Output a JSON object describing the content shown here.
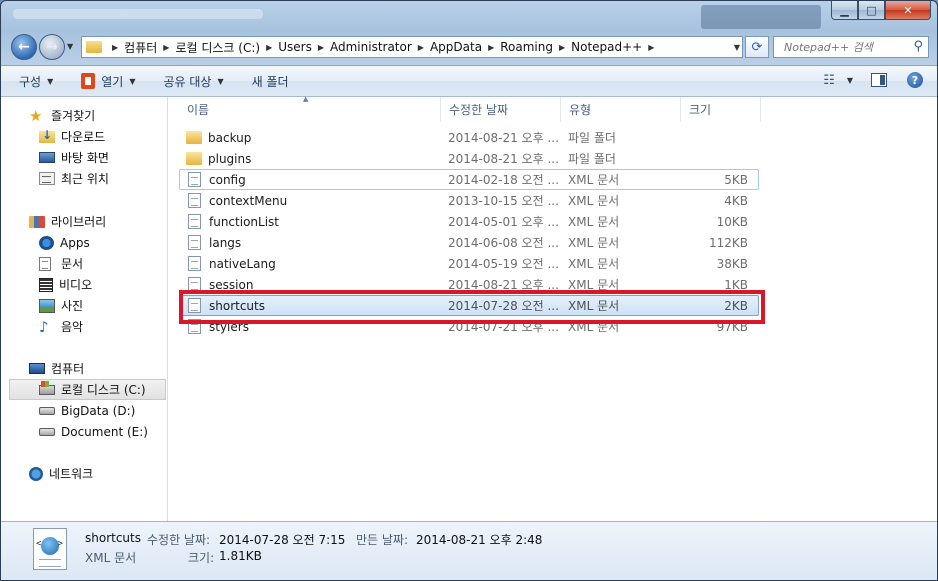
{
  "window": {
    "title": ""
  },
  "address": {
    "breadcrumbs": [
      "컴퓨터",
      "로컬 디스크 (C:)",
      "Users",
      "Administrator",
      "AppData",
      "Roaming",
      "Notepad++"
    ],
    "search_placeholder": "Notepad++ 검색"
  },
  "toolbar": {
    "organize": "구성",
    "open": "열기",
    "share": "공유 대상",
    "new_folder": "새 폴더"
  },
  "nav": {
    "favorites": {
      "label": "즐겨찾기",
      "items": [
        "다운로드",
        "바탕 화면",
        "최근 위치"
      ]
    },
    "libraries": {
      "label": "라이브러리",
      "items": [
        "Apps",
        "문서",
        "비디오",
        "사진",
        "음악"
      ]
    },
    "computer": {
      "label": "컴퓨터",
      "items": [
        "로컬 디스크 (C:)",
        "BigData (D:)",
        "Document (E:)"
      ]
    },
    "network": {
      "label": "네트워크"
    }
  },
  "columns": {
    "name": "이름",
    "date": "수정한 날짜",
    "type": "유형",
    "size": "크기"
  },
  "files": [
    {
      "name": "backup",
      "date": "2014-08-21 오후 ...",
      "type": "파일 폴더",
      "size": "",
      "kind": "folder"
    },
    {
      "name": "plugins",
      "date": "2014-08-21 오후 ...",
      "type": "파일 폴더",
      "size": "",
      "kind": "folder"
    },
    {
      "name": "config",
      "date": "2014-02-18 오전 ...",
      "type": "XML 문서",
      "size": "5KB",
      "kind": "xml"
    },
    {
      "name": "contextMenu",
      "date": "2013-10-15 오전 ...",
      "type": "XML 문서",
      "size": "4KB",
      "kind": "xml"
    },
    {
      "name": "functionList",
      "date": "2014-05-01 오후 ...",
      "type": "XML 문서",
      "size": "10KB",
      "kind": "xml"
    },
    {
      "name": "langs",
      "date": "2014-06-08 오전 ...",
      "type": "XML 문서",
      "size": "112KB",
      "kind": "xml"
    },
    {
      "name": "nativeLang",
      "date": "2014-05-19 오전 ...",
      "type": "XML 문서",
      "size": "38KB",
      "kind": "xml"
    },
    {
      "name": "session",
      "date": "2014-08-21 오후 ...",
      "type": "XML 문서",
      "size": "1KB",
      "kind": "xml"
    },
    {
      "name": "shortcuts",
      "date": "2014-07-28 오전 ...",
      "type": "XML 문서",
      "size": "2KB",
      "kind": "xml"
    },
    {
      "name": "stylers",
      "date": "2014-07-21 오후 ...",
      "type": "XML 문서",
      "size": "97KB",
      "kind": "xml"
    }
  ],
  "details": {
    "name": "shortcuts",
    "type": "XML 문서",
    "modified_label": "수정한 날짜:",
    "modified_value": "2014-07-28 오전 7:15",
    "created_label": "만든 날짜:",
    "created_value": "2014-08-21 오후 2:48",
    "size_label": "크기:",
    "size_value": "1.81KB"
  },
  "colors": {
    "highlight": "#d8182a",
    "selection": "#cde2f7",
    "chrome": "#b9d1ea"
  }
}
